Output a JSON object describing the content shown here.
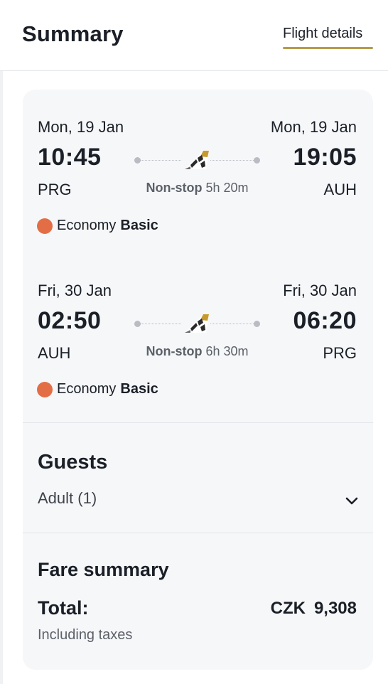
{
  "header": {
    "title": "Summary",
    "tab_label": "Flight details",
    "accent_color": "#b79a4b"
  },
  "legs": [
    {
      "departure_date": "Mon, 19 Jan",
      "arrival_date": "Mon, 19 Jan",
      "departure_time": "10:45",
      "arrival_time": "19:05",
      "origin": "PRG",
      "destination": "AUH",
      "stops": "Non-stop",
      "duration": "5h 20m",
      "cabin": "Economy",
      "fare_tier": "Basic",
      "airline_icon": "airline-tail-logo"
    },
    {
      "departure_date": "Fri, 30 Jan",
      "arrival_date": "Fri, 30 Jan",
      "departure_time": "02:50",
      "arrival_time": "06:20",
      "origin": "AUH",
      "destination": "PRG",
      "stops": "Non-stop",
      "duration": "6h 30m",
      "cabin": "Economy",
      "fare_tier": "Basic",
      "airline_icon": "airline-tail-logo"
    }
  ],
  "cabin_dot_color": "#e36e46",
  "guests": {
    "title": "Guests",
    "value": "Adult (1)",
    "toggle_icon": "chevron-down-icon"
  },
  "fare": {
    "title": "Fare summary",
    "total_label": "Total:",
    "currency": "CZK",
    "amount": "9,308",
    "note": "Including taxes"
  }
}
